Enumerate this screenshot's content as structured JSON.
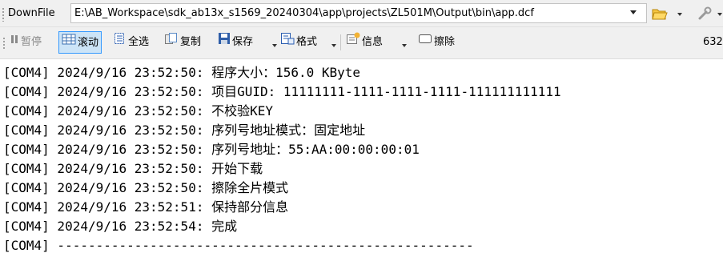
{
  "download_bar": {
    "label": "DownFile",
    "path": "E:\\AB_Workspace\\sdk_ab13x_s1569_20240304\\app\\projects\\ZL501M\\Output\\bin\\app.dcf",
    "open_icon": "folder-open-icon",
    "tool_icon": "tool-icon"
  },
  "toolbar": {
    "pause_label": "暂停",
    "scroll_label": "滚动",
    "select_all_label": "全选",
    "copy_label": "复制",
    "save_label": "保存",
    "format_label": "格式",
    "info_label": "信息",
    "erase_label": "擦除",
    "count": "632"
  },
  "log": {
    "lines": [
      "[COM4] 2024/9/16 23:52:50: 程序大小：156.0 KByte",
      "[COM4] 2024/9/16 23:52:50: 项目GUID: 11111111-1111-1111-1111-111111111111",
      "[COM4] 2024/9/16 23:52:50: 不校验KEY",
      "[COM4] 2024/9/16 23:52:50: 序列号地址模式：固定地址",
      "[COM4] 2024/9/16 23:52:50: 序列号地址：55:AA:00:00:00:01",
      "[COM4] 2024/9/16 23:52:50: 开始下载",
      "[COM4] 2024/9/16 23:52:50: 擦除全片模式",
      "[COM4] 2024/9/16 23:52:51: 保持部分信息",
      "[COM4] 2024/9/16 23:52:54: 完成",
      "[COM4] ------------------------------------------------------"
    ]
  },
  "colors": {
    "toolbar_bg": "#f0f0f0",
    "pressed_bg": "#cce4f7",
    "pressed_border": "#3399ff",
    "disabled_text": "#8a8a8a"
  }
}
